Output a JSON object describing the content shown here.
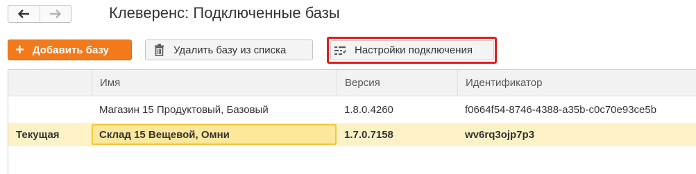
{
  "window": {
    "title": "Клеверенс: Подключенные базы"
  },
  "nav": {
    "back_icon": "arrow-left-icon",
    "forward_icon": "arrow-right-icon"
  },
  "toolbar": {
    "add_label": "Добавить базу",
    "add_icon": "plus-icon",
    "delete_label": "Удалить базу из списка",
    "delete_icon": "trash-icon",
    "settings_label": "Настройки подключения",
    "settings_icon": "settings-list-icon"
  },
  "colors": {
    "accent": "#f27a1a",
    "highlight_border": "#e41b1b",
    "current_row": "#fdf1c6",
    "selected_cell": "#fce79b"
  },
  "table": {
    "headers": [
      "",
      "Имя",
      "Версия",
      "Идентификатор"
    ],
    "rows": [
      {
        "status": "",
        "name": "Магазин 15 Продуктовый, Базовый",
        "version": "1.8.0.4260",
        "id": "f0664f54-8746-4388-a35b-c0c70e93ce5b"
      },
      {
        "status": "Текущая",
        "name": "Склад 15 Вещевой, Омни",
        "version": "1.7.0.7158",
        "id": "wv6rq3ojp7p3"
      }
    ]
  }
}
